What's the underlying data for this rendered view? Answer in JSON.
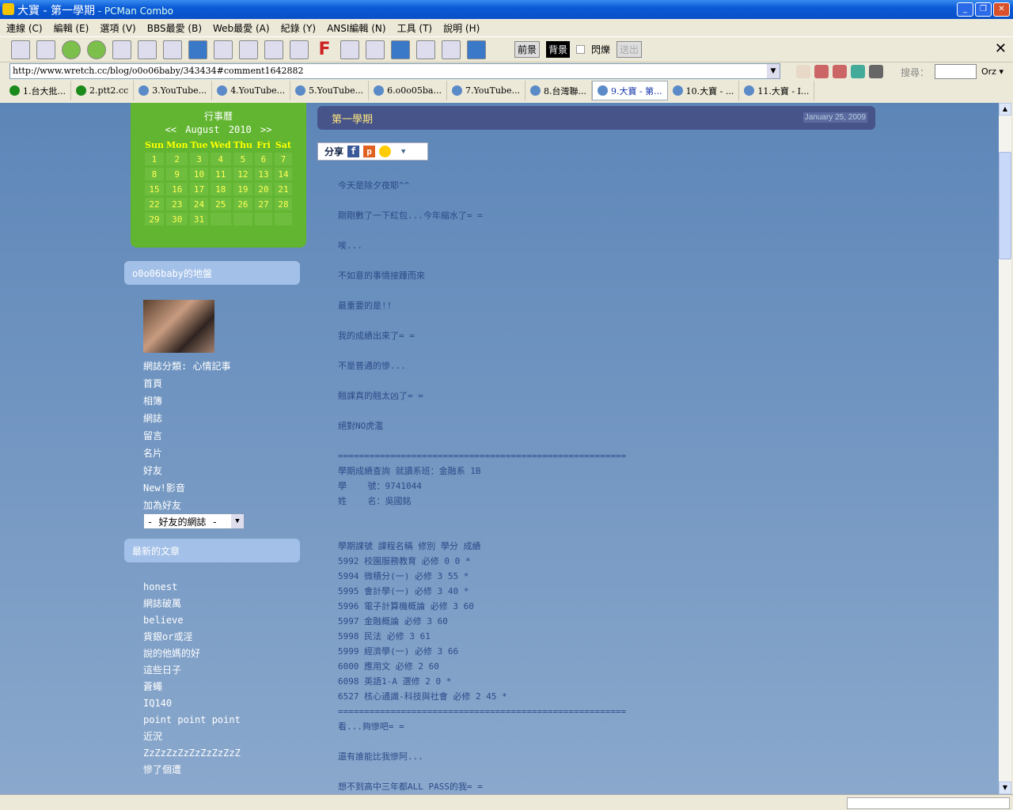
{
  "window": {
    "title": "大寶 - 第一學期",
    "app": " - PCMan Combo"
  },
  "menu": [
    "連線 (C)",
    "編輯 (E)",
    "選項 (V)",
    "BBS最愛 (B)",
    "Web最愛 (A)",
    "紀錄 (Y)",
    "ANSI編輯 (N)",
    "工具 (T)",
    "說明 (H)"
  ],
  "toolbar": {
    "fg": "前景",
    "bg": "背景",
    "blink": "閃爍",
    "send": "送出"
  },
  "address": {
    "url": "http://www.wretch.cc/blog/o0o06baby/343434#comment1642882"
  },
  "search": {
    "label": "搜尋：",
    "engine": "Orz"
  },
  "tabs": [
    {
      "label": "1.台大批...",
      "icon": "green-dot-icon"
    },
    {
      "label": "2.ptt2.cc",
      "icon": "green-dot-icon"
    },
    {
      "label": "3.YouTube...",
      "icon": "page-icon"
    },
    {
      "label": "4.YouTube...",
      "icon": "page-icon"
    },
    {
      "label": "5.YouTube...",
      "icon": "page-icon"
    },
    {
      "label": "6.o0o05ba...",
      "icon": "page-icon"
    },
    {
      "label": "7.YouTube...",
      "icon": "page-icon"
    },
    {
      "label": "8.台灣聯...",
      "icon": "page-icon"
    },
    {
      "label": "9.大寶 - 第...",
      "icon": "page-icon",
      "active": true
    },
    {
      "label": "10.大寶 - ...",
      "icon": "page-icon"
    },
    {
      "label": "11.大寶 - I...",
      "icon": "page-icon"
    }
  ],
  "calendar": {
    "title": "行事曆",
    "prev": "<<",
    "month": "August 2010",
    "next": ">>",
    "days": [
      "Sun",
      "Mon",
      "Tue",
      "Wed",
      "Thu",
      "Fri",
      "Sat"
    ],
    "weeks": [
      [
        "1",
        "2",
        "3",
        "4",
        "5",
        "6",
        "7"
      ],
      [
        "8",
        "9",
        "10",
        "11",
        "12",
        "13",
        "14"
      ],
      [
        "15",
        "16",
        "17",
        "18",
        "19",
        "20",
        "21"
      ],
      [
        "22",
        "23",
        "24",
        "25",
        "26",
        "27",
        "28"
      ],
      [
        "29",
        "30",
        "31",
        "",
        "",
        "",
        ""
      ]
    ]
  },
  "sidebar": {
    "owner_title": "o0o06baby的地盤",
    "links": [
      "網誌分類: 心情記事",
      "首頁",
      "相簿",
      "網誌",
      "留言",
      "名片",
      "好友",
      "New!影音",
      "加為好友"
    ],
    "friends_select": "- 好友的網誌 -",
    "recent_title": "最新的文章",
    "recent": [
      "honest",
      "網誌破萬",
      "believe",
      "貨銀or或淫",
      "說的他媽的好",
      "這些日子",
      "蒼蠅",
      "IQ140",
      "point point point",
      "近況",
      "ZzZzZzZzZzZzZzZzZ",
      "慘了個遭"
    ]
  },
  "post": {
    "title": "第一學期",
    "date": "January 25, 2009",
    "share": "分享",
    "lines": [
      "今天是除夕夜耶^^",
      "",
      "剛剛數了一下紅包...今年縮水了= =",
      "",
      "唉...",
      "",
      "不如意的事情接踵而來",
      "",
      "最重要的是!!",
      "",
      "我的成績出來了= =",
      "",
      "不是普通的慘...",
      "",
      "翹課真的翹太凶了= =",
      "",
      "絕對NO虎濫",
      "",
      "=======================================================",
      "學期成績查詢 就讀系班：金融系 1B",
      "學    號：9741044",
      "姓    名：吳國銘",
      "",
      "",
      "學期課號 課程名稱 修別 學分 成績",
      "5992 校園服務教育 必修 0 0 *",
      "5994 微積分(一) 必修 3 55 *",
      "5995 會計學(一) 必修 3 40 *",
      "5996 電子計算機概論 必修 3 60",
      "5997 金融概論 必修 3 60",
      "5998 民法 必修 3 61",
      "5999 經濟學(一) 必修 3 66",
      "6000 應用文 必修 2 60",
      "6098 英語1-A 選修 2 0 *",
      "6527 核心通識-科技與社會 必修 2 45 *",
      "=======================================================",
      "看...夠慘吧= =",
      "",
      "還有誰能比我慘阿...",
      "",
      "想不到高中三年都ALL PASS的我= ="
    ]
  }
}
